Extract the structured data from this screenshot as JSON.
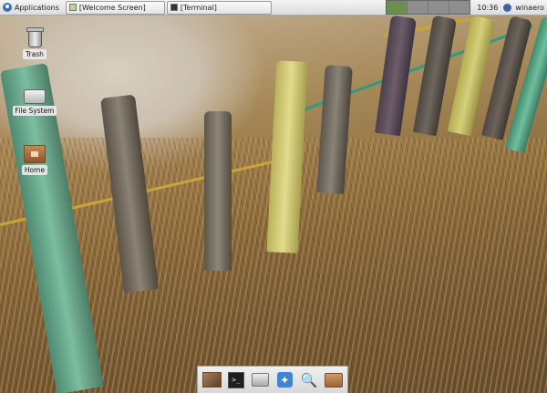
{
  "panel": {
    "applications_label": "Applications",
    "tasks": [
      {
        "label": "[Welcome Screen]"
      },
      {
        "label": "[Terminal]"
      }
    ],
    "workspaces": 4,
    "active_workspace": 1,
    "clock": "10:36",
    "user": "winaero"
  },
  "desktop": {
    "icons": [
      {
        "label": "Trash",
        "icon": "trash-icon"
      },
      {
        "label": "File System",
        "icon": "drive-icon"
      },
      {
        "label": "Home",
        "icon": "home-folder-icon"
      }
    ]
  },
  "dock": {
    "items": [
      {
        "icon": "show-desktop-icon"
      },
      {
        "icon": "terminal-icon",
        "glyph": ">_"
      },
      {
        "icon": "drive-icon"
      },
      {
        "icon": "web-browser-icon",
        "glyph": "✦"
      },
      {
        "icon": "search-icon",
        "glyph": "🔍"
      },
      {
        "icon": "folder-icon"
      }
    ]
  },
  "colors": {
    "panel_bg": "#e6e6e6",
    "active_workspace": "#6b8f4e",
    "inactive_workspace": "#8e8e8e"
  }
}
